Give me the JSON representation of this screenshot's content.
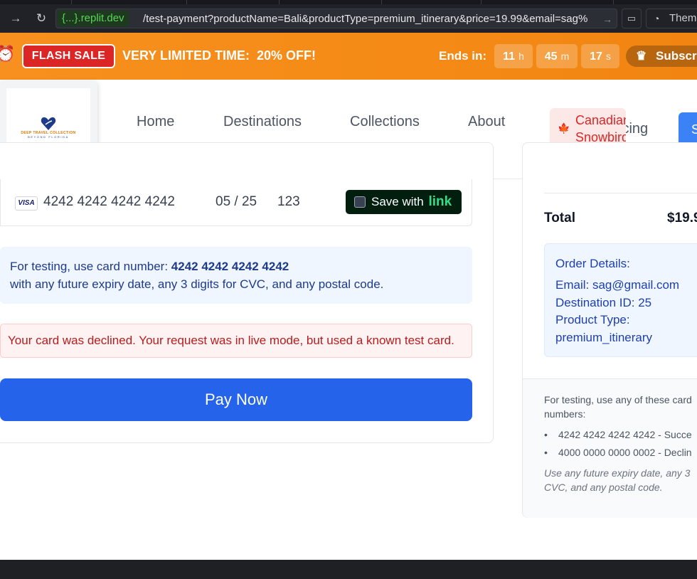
{
  "browser": {
    "host": "{...}.replit.dev",
    "path": "/test-payment?productName=Bali&productType=premium_itinerary&price=19.99&email=sag%",
    "theme_label": "Them"
  },
  "flash": {
    "badge": "FLASH SALE",
    "message": "VERY LIMITED TIME:  20% OFF!",
    "ends_label": "Ends in:",
    "hours": "11",
    "hours_unit": "h",
    "minutes": "45",
    "minutes_unit": "m",
    "seconds": "17",
    "seconds_unit": "s",
    "subscribe_label": "Subscri"
  },
  "header": {
    "logo_line1": "DEEP TRAVEL COLLECTION",
    "logo_line2": "BEYOND FLORIDA",
    "nav": [
      "Home",
      "Destinations",
      "Collections",
      "About"
    ],
    "snowbirds_line1": "Canadian",
    "snowbirds_line2": "Snowbirds",
    "pricing_label": "icing",
    "signin_label": "S"
  },
  "card": {
    "brand": "VISA",
    "number": "4242 4242 4242 4242",
    "expiry": "05 / 25",
    "cvc": "123",
    "link_save_label": "Save with",
    "link_brand": "link"
  },
  "info": {
    "prefix": "For testing, use card number: ",
    "card": "4242 4242 4242 4242",
    "suffix": "with any future expiry date, any 3 digits for CVC, and any postal code."
  },
  "error_message": "Your card was declined. Your request was in live mode, but used a known test card.",
  "pay_button": "Pay Now",
  "summary": {
    "total_label": "Total",
    "total_value": "$19.9",
    "order_title": "Order Details:",
    "email_line": "Email: sag@gmail.com",
    "destination_line": "Destination ID: 25",
    "product_type_label": "Product Type:",
    "product_type_value": "premium_itinerary",
    "test_intro": "For testing, use any of these card numbers:",
    "test_cards": [
      "4242 4242 4242 4242 - Succe",
      "4000 0000 0000 0002 - Declin"
    ],
    "test_footer": "Use any future expiry date, any 3 CVC, and any postal code."
  },
  "colors": {
    "flash_orange": "#f7901e",
    "flash_badge_red": "#dc2626",
    "primary_blue": "#2563eb",
    "error_red": "#b91c1c",
    "link_green": "#33dd88"
  },
  "icons": [
    "forward-arrow-icon",
    "reload-icon",
    "screen-icon",
    "palette-icon",
    "alarm-clock-icon",
    "crown-icon",
    "canada-flag-icon",
    "visa-icon",
    "heart-logo-icon"
  ]
}
